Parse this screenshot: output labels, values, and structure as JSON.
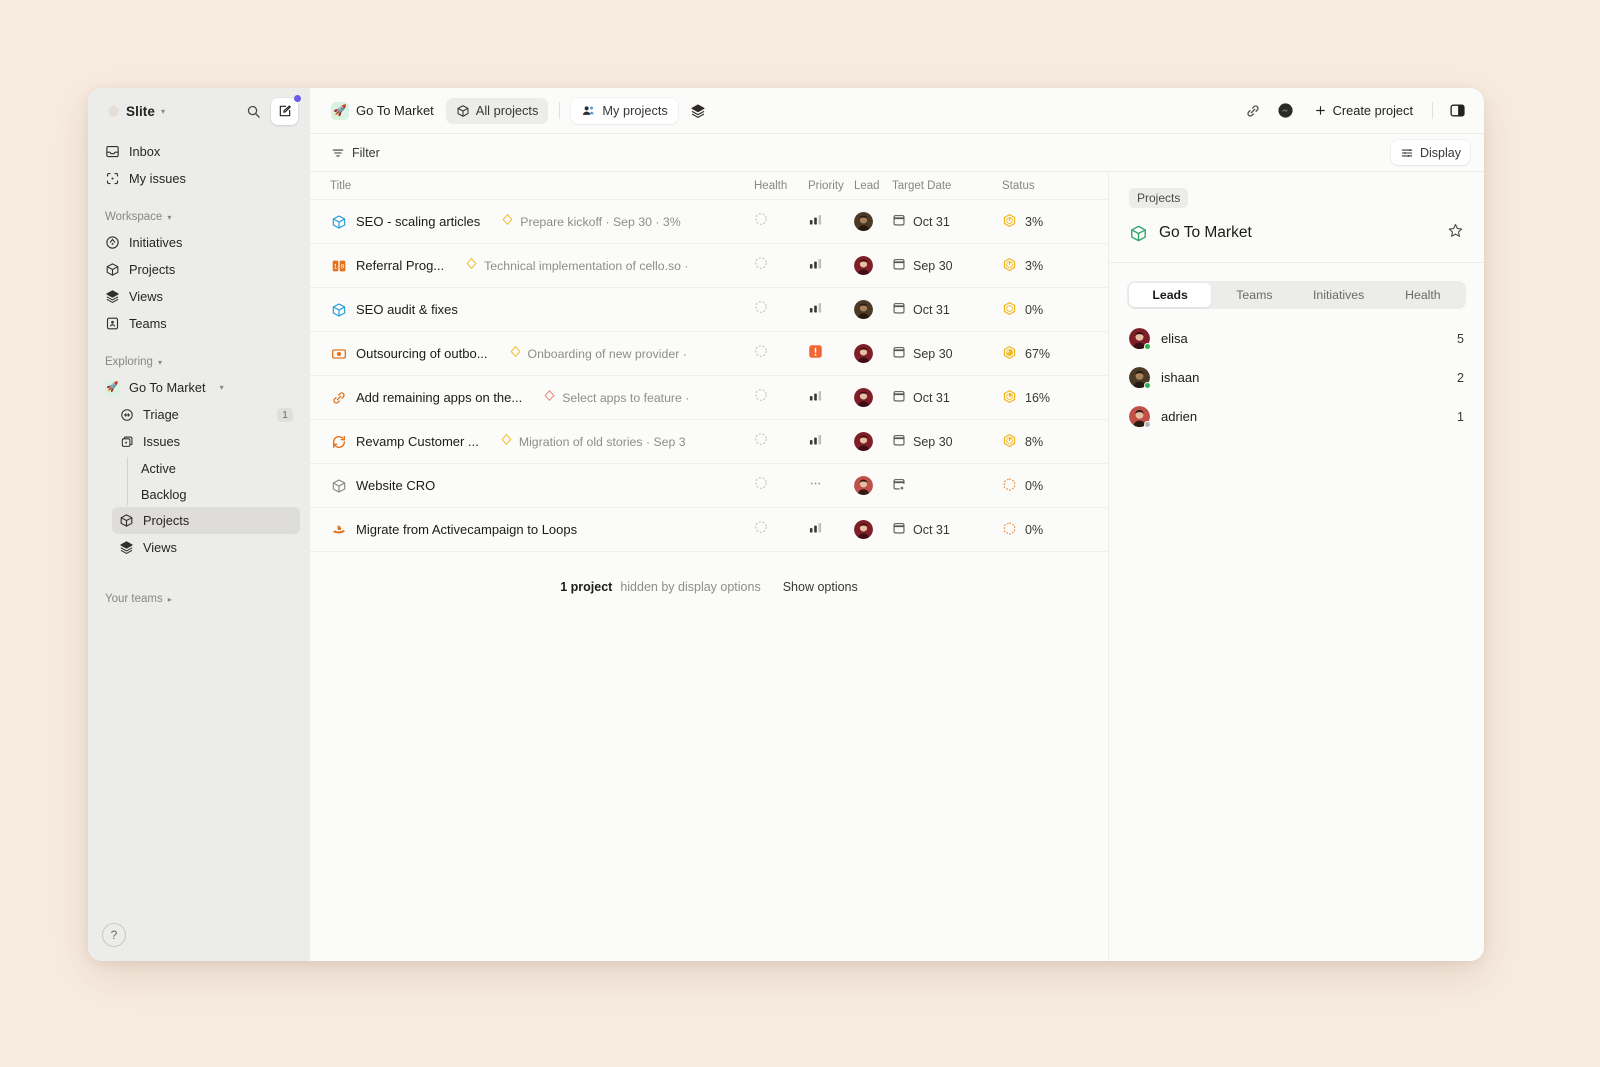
{
  "sidebar": {
    "workspace_name": "Slite",
    "search_icon": "search-icon",
    "compose_icon": "compose-icon",
    "top_items": [
      {
        "label": "Inbox",
        "icon": "inbox-icon"
      },
      {
        "label": "My issues",
        "icon": "my-issues-icon"
      }
    ],
    "workspace_section": {
      "label": "Workspace",
      "items": [
        {
          "label": "Initiatives",
          "icon": "initiatives-icon"
        },
        {
          "label": "Projects",
          "icon": "projects-icon"
        },
        {
          "label": "Views",
          "icon": "views-icon"
        },
        {
          "label": "Teams",
          "icon": "teams-icon"
        }
      ]
    },
    "exploring_section": {
      "label": "Exploring",
      "project": {
        "label": "Go To Market",
        "emoji": "🚀"
      },
      "items": [
        {
          "label": "Triage",
          "icon": "triage-icon",
          "badge": "1"
        },
        {
          "label": "Issues",
          "icon": "issues-icon"
        }
      ],
      "sub_items": [
        {
          "label": "Active"
        },
        {
          "label": "Backlog"
        }
      ],
      "after_items": [
        {
          "label": "Projects",
          "icon": "projects-icon",
          "active": true
        },
        {
          "label": "Views",
          "icon": "views-icon",
          "active": false
        }
      ]
    },
    "your_teams_label": "Your teams",
    "help_label": "?"
  },
  "topbar": {
    "breadcrumb_project": "Go To Market",
    "breadcrumb_emoji": "🚀",
    "all_projects": "All projects",
    "my_projects": "My projects",
    "layers_icon": "layers-icon",
    "link_icon": "link-icon",
    "messenger_icon": "messenger-icon",
    "create_project": "Create project",
    "panel_toggle_icon": "right-panel-toggle-icon"
  },
  "filterbar": {
    "filter_label": "Filter",
    "display_label": "Display"
  },
  "table": {
    "columns": [
      "Title",
      "Health",
      "Priority",
      "Lead",
      "Target Date",
      "Status"
    ],
    "rows": [
      {
        "icon": "cube-blue-icon",
        "title": "SEO - scaling articles",
        "milestone": "Prepare kickoff",
        "milestone_meta": "· Sep 30 · 3%",
        "milestone_icon_color": "#f0c23c",
        "health": "no-health",
        "priority": "medium",
        "lead": "ishaan",
        "date": "Oct 31",
        "status_pct": "3%",
        "status_kind": "in-progress"
      },
      {
        "icon": "referral-orange-icon",
        "title": "Referral Prog...",
        "milestone": "Technical implementation of cello.so",
        "milestone_meta": "·",
        "milestone_icon_color": "#f0c23c",
        "health": "no-health",
        "priority": "medium",
        "lead": "elisa",
        "date": "Sep 30",
        "status_pct": "3%",
        "status_kind": "in-progress"
      },
      {
        "icon": "cube-blue-icon",
        "title": "SEO audit & fixes",
        "milestone": "",
        "milestone_meta": "",
        "milestone_icon_color": "",
        "health": "no-health",
        "priority": "medium",
        "lead": "ishaan",
        "date": "Oct 31",
        "status_pct": "0%",
        "status_kind": "in-progress"
      },
      {
        "icon": "banknote-orange-icon",
        "title": "Outsourcing of outbo...",
        "milestone": "Onboarding of new provider",
        "milestone_meta": "·",
        "milestone_icon_color": "#f0c23c",
        "health": "no-health",
        "priority": "urgent",
        "lead": "elisa",
        "date": "Sep 30",
        "status_pct": "67%",
        "status_kind": "in-progress"
      },
      {
        "icon": "link-orange-icon",
        "title": "Add remaining apps on the...",
        "milestone": "Select apps to feature",
        "milestone_meta": "·",
        "milestone_icon_color": "#e8917f",
        "health": "no-health",
        "priority": "medium",
        "lead": "elisa",
        "date": "Oct 31",
        "status_pct": "16%",
        "status_kind": "in-progress"
      },
      {
        "icon": "refresh-orange-icon",
        "title": "Revamp Customer ...",
        "milestone": "Migration of old stories",
        "milestone_meta": "· Sep 3",
        "milestone_icon_color": "#f0c23c",
        "health": "no-health",
        "priority": "medium",
        "lead": "elisa",
        "date": "Sep 30",
        "status_pct": "8%",
        "status_kind": "in-progress"
      },
      {
        "icon": "cube-gray-icon",
        "title": "Website CRO",
        "milestone": "",
        "milestone_meta": "",
        "milestone_icon_color": "",
        "health": "no-health",
        "priority": "none",
        "lead": "adrien",
        "date": "",
        "status_pct": "0%",
        "status_kind": "planned"
      },
      {
        "icon": "boat-orange-icon",
        "title": "Migrate from Activecampaign to Loops",
        "milestone": "",
        "milestone_meta": "",
        "milestone_icon_color": "",
        "health": "no-health",
        "priority": "medium",
        "lead": "elisa",
        "date": "Oct 31",
        "status_pct": "0%",
        "status_kind": "planned"
      }
    ],
    "hidden_note": {
      "count": "1 project",
      "text": "hidden by display options",
      "action": "Show options"
    }
  },
  "right_panel": {
    "breadcrumb": "Projects",
    "title": "Go To Market",
    "star_icon": "star-icon",
    "tabs": [
      "Leads",
      "Teams",
      "Initiatives",
      "Health"
    ],
    "active_tab": "Leads",
    "leads": [
      {
        "name": "elisa",
        "count": "5",
        "presence": "#2bb24c"
      },
      {
        "name": "ishaan",
        "count": "2",
        "presence": "#2bb24c"
      },
      {
        "name": "adrien",
        "count": "1",
        "presence": "#b8b6b2"
      }
    ]
  },
  "colors": {
    "page_background": "#f8ece0",
    "sidebar": "#ececeb",
    "accent_purple": "#6b5ce7",
    "status_yellow": "#f0b922",
    "status_orange": "#e8914a",
    "urgent_orange": "#f36633"
  }
}
